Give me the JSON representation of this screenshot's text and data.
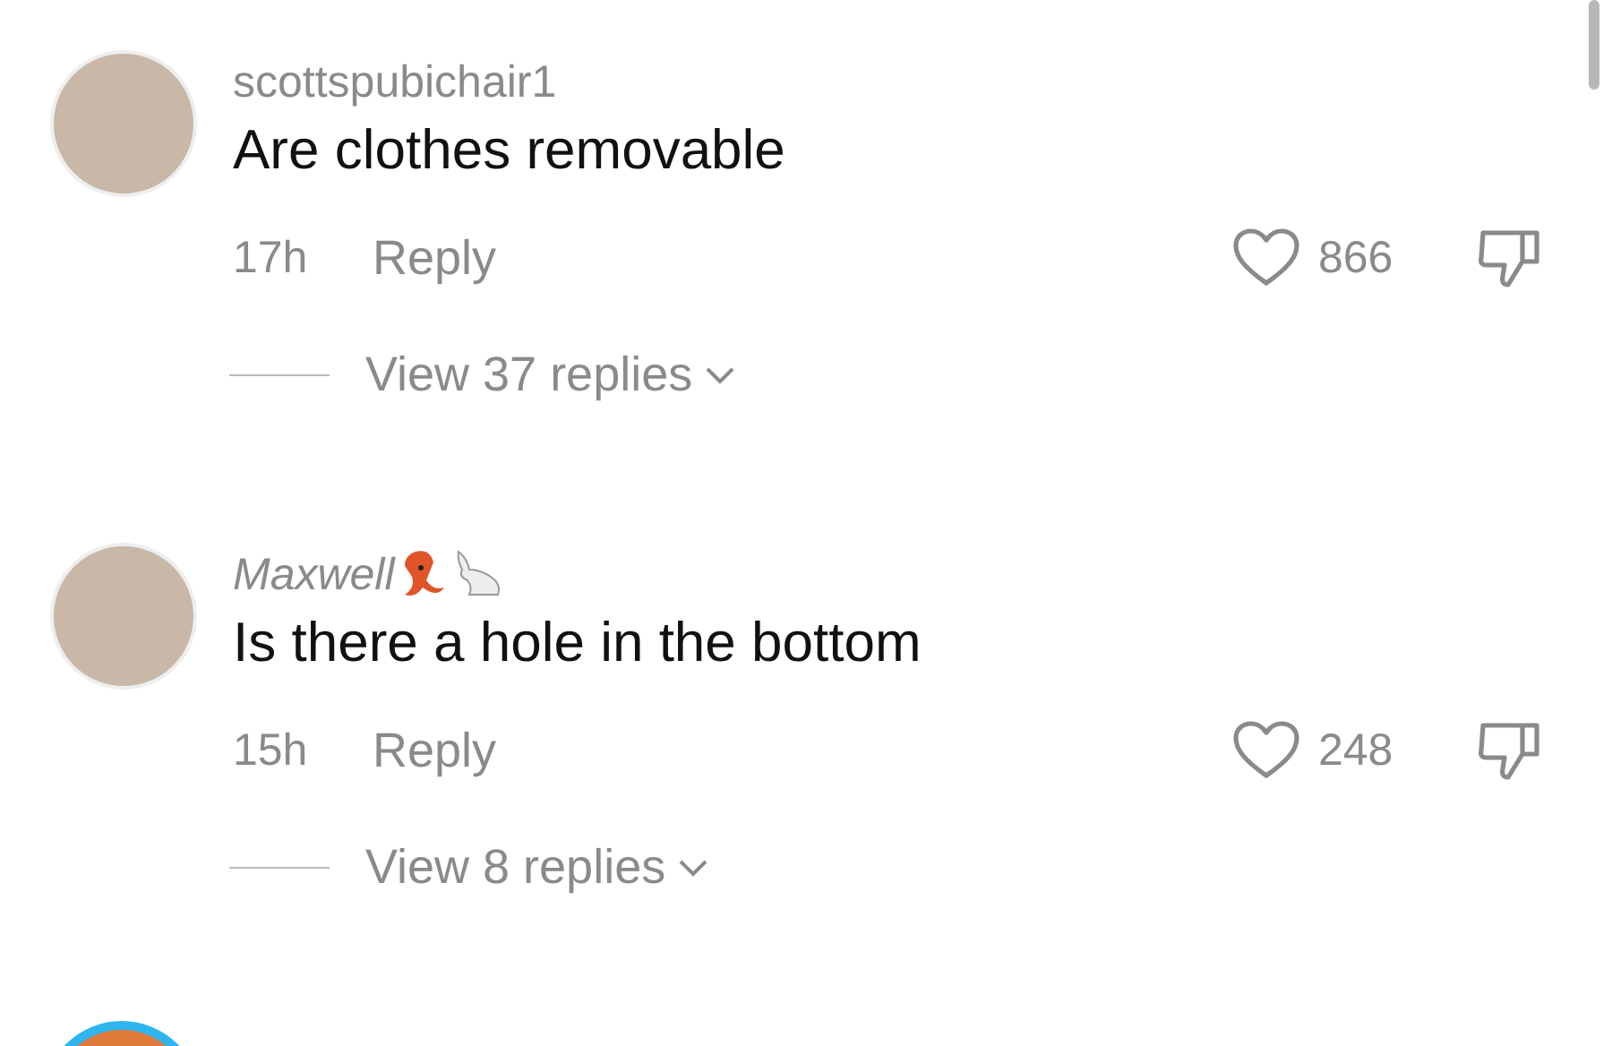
{
  "comments": [
    {
      "username": "scottspubichair1",
      "italic": false,
      "text": "Are clothes removable",
      "age": "17h",
      "reply": "Reply",
      "likes": "866",
      "liked": false,
      "view_replies": "View 37 replies"
    },
    {
      "username": "Maxwell",
      "italic": true,
      "emoji": [
        {
          "kind": "squid"
        },
        {
          "kind": "rabbit"
        }
      ],
      "text": "Is there a hole in the bottom",
      "age": "15h",
      "reply": "Reply",
      "likes": "248",
      "liked": false,
      "view_replies": "View 8 replies"
    }
  ]
}
